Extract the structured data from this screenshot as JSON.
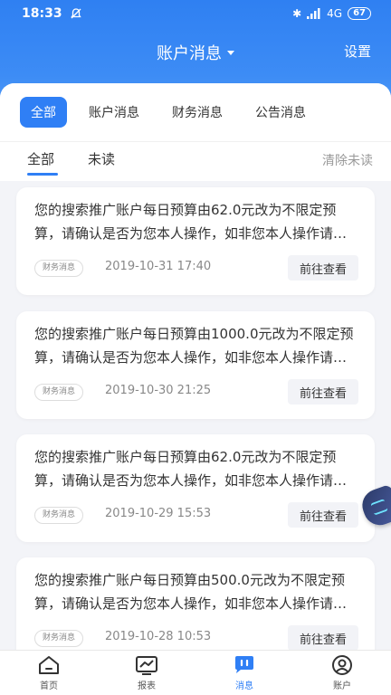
{
  "statusbar": {
    "time": "18:33",
    "network": "4G",
    "battery": "67"
  },
  "header": {
    "title": "账户消息",
    "settings": "设置"
  },
  "category_tabs": [
    {
      "label": "全部",
      "active": true
    },
    {
      "label": "账户消息",
      "active": false
    },
    {
      "label": "财务消息",
      "active": false
    },
    {
      "label": "公告消息",
      "active": false
    }
  ],
  "filter": {
    "all": "全部",
    "unread": "未读",
    "clear_unread": "清除未读"
  },
  "messages": [
    {
      "text": "您的搜索推广账户每日预算由62.0元改为不限定预算，请确认是否为您本人操作，如非您本人操作请尽快修改密码",
      "badge": "财务消息",
      "time": "2019-10-31 17:40",
      "action": "前往查看"
    },
    {
      "text": "您的搜索推广账户每日预算由1000.0元改为不限定预算，请确认是否为您本人操作，如非您本人操作请尽快修改密码",
      "badge": "财务消息",
      "time": "2019-10-30 21:25",
      "action": "前往查看"
    },
    {
      "text": "您的搜索推广账户每日预算由62.0元改为不限定预算，请确认是否为您本人操作，如非您本人操作请尽快修改密码",
      "badge": "财务消息",
      "time": "2019-10-29 15:53",
      "action": "前往查看"
    },
    {
      "text": "您的搜索推广账户每日预算由500.0元改为不限定预算，请确认是否为您本人操作，如非您本人操作请尽快修改密码",
      "badge": "财务消息",
      "time": "2019-10-28 10:53",
      "action": "前往查看"
    }
  ],
  "bottom_nav": [
    {
      "label": "首页",
      "icon": "home-icon"
    },
    {
      "label": "报表",
      "icon": "chart-icon"
    },
    {
      "label": "消息",
      "icon": "message-icon",
      "active": true
    },
    {
      "label": "账户",
      "icon": "account-icon"
    }
  ],
  "colors": {
    "accent": "#2f7ff5",
    "header_gradient_top": "#2f80f2"
  }
}
